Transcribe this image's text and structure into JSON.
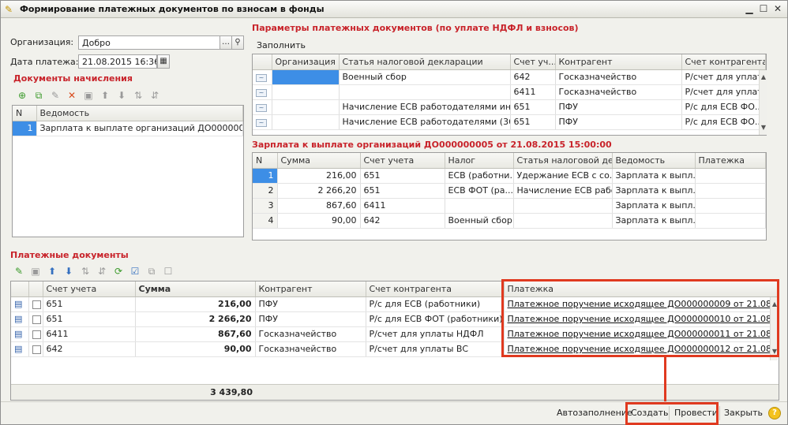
{
  "window": {
    "title": "Формирование платежных документов по взносам в фонды",
    "minimize_icon": "minimize-icon",
    "maximize_icon": "maximize-icon",
    "close_icon": "close-icon"
  },
  "header": {
    "org_label": "Организация:",
    "org_value": "Добро",
    "date_label": "Дата платежа:",
    "date_value": "21.08.2015 16:36:2"
  },
  "accrual_docs": {
    "title": "Документы начисления",
    "columns": [
      "N",
      "Ведомость"
    ],
    "rows": [
      {
        "n": "1",
        "vedomost": "Зарплата к выплате организаций ДО000000005..."
      }
    ]
  },
  "params": {
    "title": "Параметры платежных документов (по уплате НДФЛ и взносов)",
    "fill_button": "Заполнить",
    "columns": [
      "Организация",
      "Статья налоговой декларации",
      "Счет уч...",
      "Контрагент",
      "Счет контрагента"
    ],
    "rows": [
      {
        "org": "",
        "article": "Военный сбор",
        "account": "642",
        "counterparty": "Госказначейство",
        "cp_account": "Р/счет для уплат..."
      },
      {
        "org": "",
        "article": "",
        "account": "6411",
        "counterparty": "Госказначейство",
        "cp_account": "Р/счет для уплат..."
      },
      {
        "org": "",
        "article": "Начисление ЕСВ работодателями инва...",
        "account": "651",
        "counterparty": "ПФУ",
        "cp_account": "Р/с для ЕСВ ФО..."
      },
      {
        "org": "",
        "article": "Начисление ЕСВ работодателями (36,7...",
        "account": "651",
        "counterparty": "ПФУ",
        "cp_account": "Р/с для ЕСВ ФО..."
      }
    ]
  },
  "salary": {
    "title": "Зарплата к выплате организаций ДО000000005 от 21.08.2015 15:00:00",
    "columns": [
      "N",
      "Сумма",
      "Счет учета",
      "Налог",
      "Статья налоговой де...",
      "Ведомость",
      "Платежка"
    ],
    "rows": [
      {
        "n": "1",
        "sum": "216,00",
        "account": "651",
        "tax": "ЕСВ (работни...",
        "article": "Удержание ЕСВ с со...",
        "vedomost": "Зарплата к выпл...",
        "payment": ""
      },
      {
        "n": "2",
        "sum": "2 266,20",
        "account": "651",
        "tax": "ЕСВ ФОТ (ра...",
        "article": "Начисление ЕСВ рабо...",
        "vedomost": "Зарплата к выпл...",
        "payment": ""
      },
      {
        "n": "3",
        "sum": "867,60",
        "account": "6411",
        "tax": "",
        "article": "",
        "vedomost": "Зарплата к выпл...",
        "payment": ""
      },
      {
        "n": "4",
        "sum": "90,00",
        "account": "642",
        "tax": "Военный сбор",
        "article": "",
        "vedomost": "Зарплата к выпл...",
        "payment": ""
      }
    ]
  },
  "payments": {
    "title": "Платежные документы",
    "columns": [
      "Счет учета",
      "Сумма",
      "Контрагент",
      "Счет контрагента",
      "Платежка"
    ],
    "rows": [
      {
        "account": "651",
        "sum": "216,00",
        "counterparty": "ПФУ",
        "cp_account": "Р/с для ЕСВ (работники)",
        "payment": "Платежное поручение исходящее ДО000000009 от 21.08.2015 1..."
      },
      {
        "account": "651",
        "sum": "2 266,20",
        "counterparty": "ПФУ",
        "cp_account": "Р/с для ЕСВ ФОТ (работники)",
        "payment": "Платежное поручение исходящее ДО000000010 от 21.08.2015 1..."
      },
      {
        "account": "6411",
        "sum": "867,60",
        "counterparty": "Госказначейство",
        "cp_account": "Р/счет для уплаты НДФЛ",
        "payment": "Платежное поручение исходящее ДО000000011 от 21.08.2015 1..."
      },
      {
        "account": "642",
        "sum": "90,00",
        "counterparty": "Госказначейство",
        "cp_account": "Р/счет для уплаты ВС",
        "payment": "Платежное поручение исходящее ДО000000012 от 21.08.2015 1..."
      }
    ],
    "total": "3 439,80"
  },
  "footer": {
    "autofill": "Автозаполнение",
    "create": "Создать",
    "post": "Провести",
    "close": "Закрыть",
    "help": "?"
  },
  "colors": {
    "section_title": "#c8232a",
    "highlight": "#e03a20",
    "selection": "#3d8ee6"
  }
}
